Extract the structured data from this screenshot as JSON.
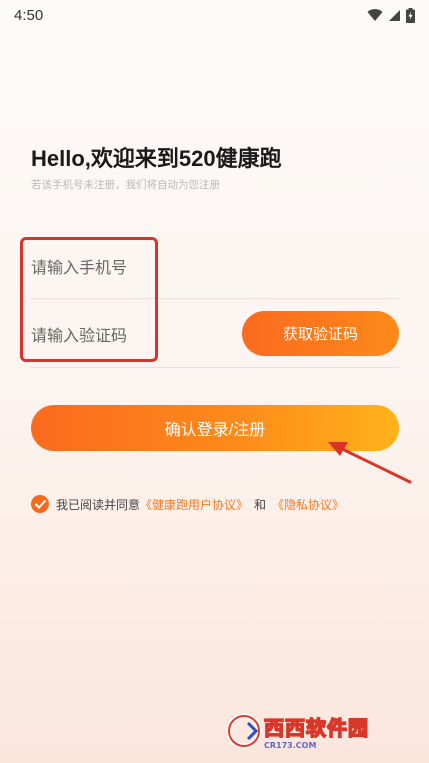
{
  "status_bar": {
    "time": "4:50"
  },
  "login": {
    "heading": "Hello,欢迎来到520健康跑",
    "subheading": "若该手机号未注册，我们将自动为您注册",
    "phone_placeholder": "请输入手机号",
    "code_placeholder": "请输入验证码",
    "get_code_label": "获取验证码",
    "submit_label": "确认登录/注册"
  },
  "agreement": {
    "checked": true,
    "prefix": "我已阅读并同意",
    "link_user_agreement": "《健康跑用户协议》",
    "conjunction": "和",
    "link_privacy": "《隐私协议》"
  },
  "watermark": {
    "brand": "西西软件园",
    "domain": "CR173.COM"
  },
  "colors": {
    "accent": "#fb6a1e",
    "accent_end": "#ffb21a",
    "annotation": "#d9342a"
  }
}
